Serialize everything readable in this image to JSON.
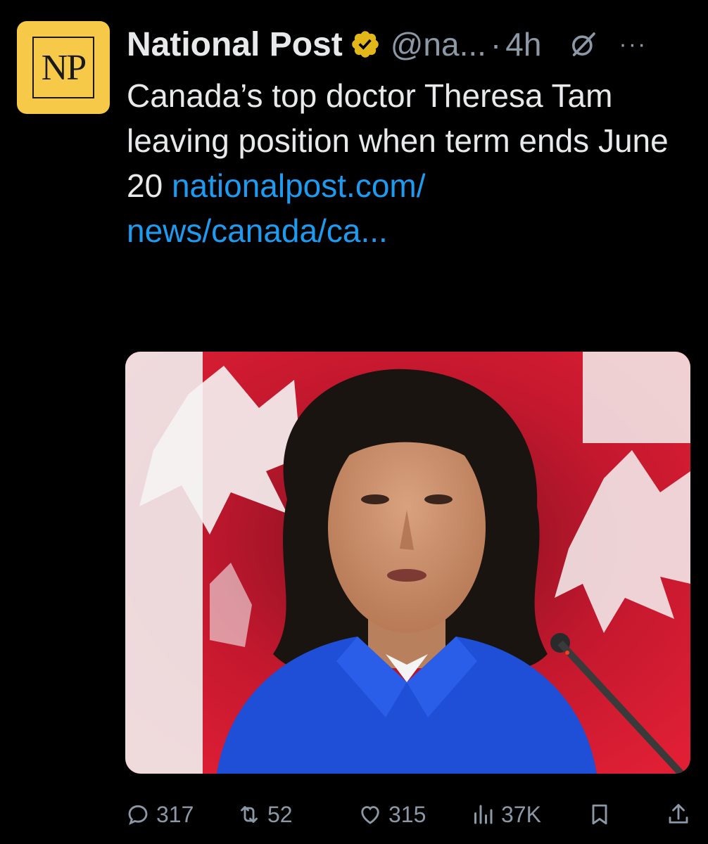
{
  "author": {
    "avatar_text": "NP",
    "name": "National Post",
    "handle": "@na...",
    "separator": "·",
    "time": "4h",
    "more": "···"
  },
  "tweet": {
    "text": "Canada’s top doctor Theresa Tam leaving position when term ends June 20",
    "link_line1": "nationalpost.com/",
    "link_line2": "news/canada/ca..."
  },
  "actions": {
    "replies": "317",
    "reposts": "52",
    "likes": "315",
    "views": "37K"
  },
  "icons": [
    "verified-badge-icon",
    "grok-icon",
    "more-icon",
    "reply-icon",
    "repost-icon",
    "like-icon",
    "views-icon",
    "bookmark-icon",
    "share-icon"
  ],
  "colors": {
    "background": "#000000",
    "text": "#e7e9ea",
    "secondary": "#8b98a5",
    "link": "#1d9bf0",
    "verified": "#e2b719",
    "avatar_bg": "#f7c948"
  }
}
